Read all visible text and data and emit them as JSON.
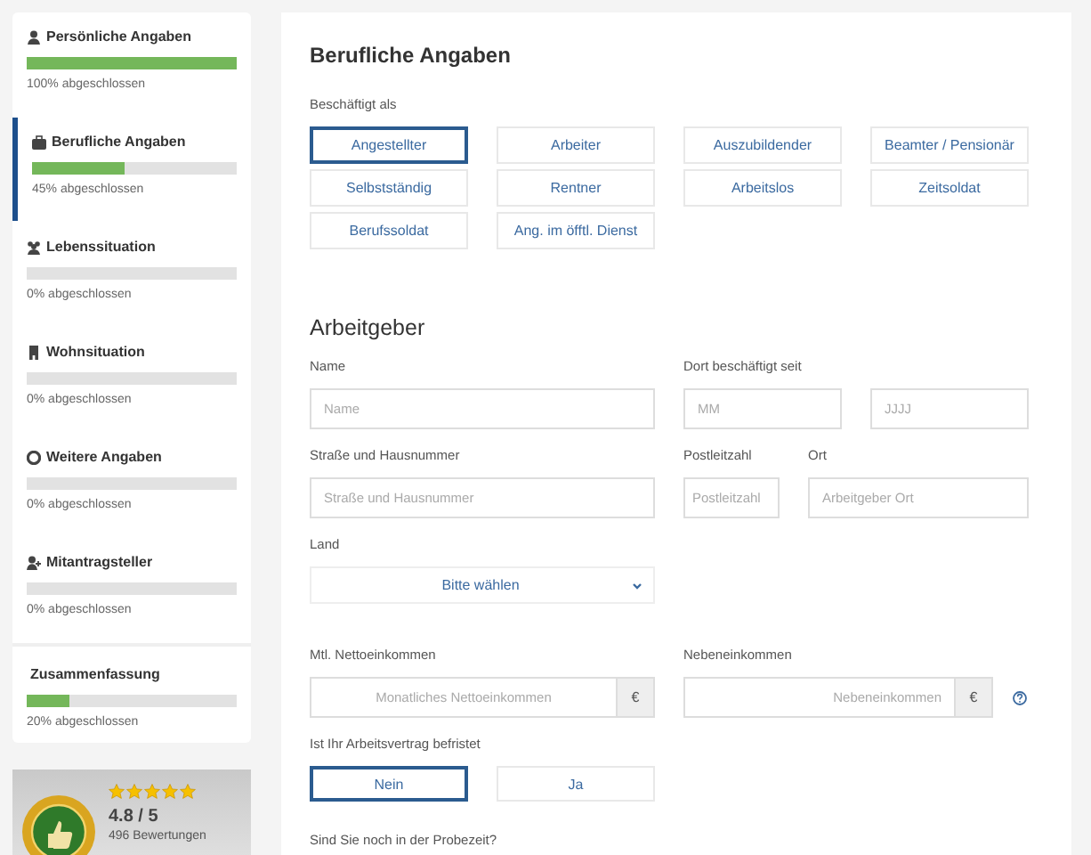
{
  "sidebar": {
    "steps": [
      {
        "title": "Persönliche Angaben",
        "level": 1,
        "reading": "100% abgeschlossen",
        "selected": false
      },
      {
        "title": "Berufliche Angaben",
        "level": 0.45,
        "reading": "45% abgeschlossen",
        "selected": true
      },
      {
        "title": "Lebenssituation",
        "level": 0,
        "reading": "0% abgeschlossen",
        "selected": false
      },
      {
        "title": "Wohnsituation",
        "level": 0,
        "reading": "0% abgeschlossen",
        "selected": false
      },
      {
        "title": "Weitere Angaben",
        "level": 0,
        "reading": "0% abgeschlossen",
        "selected": false
      },
      {
        "title": "Mitantragsteller",
        "level": 0,
        "reading": "0% abgeschlossen",
        "selected": false
      }
    ],
    "summary": {
      "title": "Zusammenfassung",
      "level": 0.2,
      "reading": "20% abgeschlossen"
    }
  },
  "rating": {
    "stars": 5,
    "score": "4.8 / 5",
    "count": "496 Bewertungen"
  },
  "main": {
    "title": "Berufliche Angaben",
    "employment": {
      "label": "Beschäftigt als",
      "options": [
        {
          "label": "Angestellter",
          "selected": true
        },
        {
          "label": "Arbeiter",
          "selected": false
        },
        {
          "label": "Auszubildender",
          "selected": false
        },
        {
          "label": "Beamter / Pensionär",
          "selected": false
        },
        {
          "label": "Selbstständig",
          "selected": false
        },
        {
          "label": "Rentner",
          "selected": false
        },
        {
          "label": "Arbeitslos",
          "selected": false
        },
        {
          "label": "Zeitsoldat",
          "selected": false
        },
        {
          "label": "Berufssoldat",
          "selected": false
        },
        {
          "label": "Ang. im öfftl. Dienst",
          "selected": false
        }
      ]
    },
    "employer": {
      "heading": "Arbeitgeber",
      "name": {
        "label": "Name",
        "placeholder": "Name"
      },
      "since": {
        "label": "Dort beschäftigt seit",
        "month_placeholder": "MM",
        "year_placeholder": "JJJJ"
      },
      "street": {
        "label": "Straße und Hausnummer",
        "placeholder": "Straße und Hausnummer"
      },
      "postcode": {
        "label": "Postleitzahl",
        "placeholder": "Postleitzahl"
      },
      "city": {
        "label": "Ort",
        "placeholder": "Arbeitgeber Ort"
      },
      "country": {
        "label": "Land",
        "value": "Bitte wählen"
      },
      "net_income": {
        "label": "Mtl. Nettoeinkommen",
        "placeholder": "Monatliches Nettoeinkommen",
        "unit": "€"
      },
      "side_income": {
        "label": "Nebeneinkommen",
        "placeholder": "Nebeneinkommen",
        "unit": "€"
      },
      "fixed_term": {
        "label": "Ist Ihr Arbeitsvertrag befristet",
        "options": [
          {
            "label": "Nein",
            "selected": true
          },
          {
            "label": "Ja",
            "selected": false
          }
        ]
      },
      "probation": {
        "label": "Sind Sie noch in der Probezeit?"
      }
    }
  }
}
